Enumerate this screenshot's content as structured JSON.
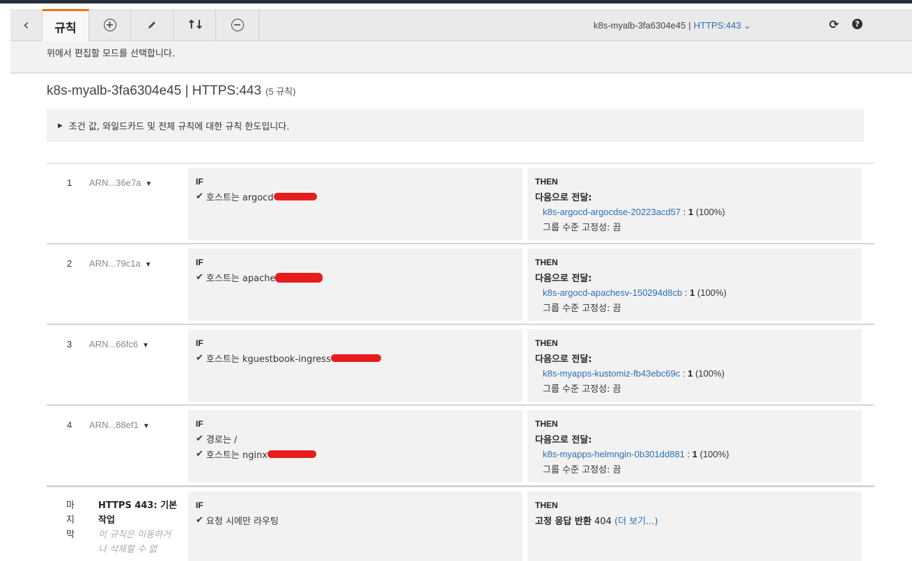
{
  "toolbar": {
    "back_icon": "chevron-left-icon",
    "rules_tab_label": "규칙",
    "add_icon": "plus-circle-icon",
    "edit_icon": "pencil-icon",
    "reorder_icon": "reorder-arrows-icon",
    "remove_icon": "minus-circle-icon",
    "listener_name": "k8s-myalb-3fa6304e45",
    "listener_separator": "|",
    "listener_port": "HTTPS:443",
    "refresh_icon": "refresh-icon",
    "help_icon": "help-icon",
    "accent_color": "#ec7211"
  },
  "mode_hint": "위에서 편집할 모드를 선택합니다.",
  "page": {
    "title": "k8s-myalb-3fa6304e45 | HTTPS:443",
    "rule_count": "(5 규칙)"
  },
  "info_box": {
    "text": "조건 값, 와일드카드 및 전체 규칙에 대한 규칙 한도입니다."
  },
  "labels": {
    "if": "IF",
    "then": "THEN",
    "forward_to": "다음으로 전달:",
    "stickiness": "그룹 수준 고정성: 끔",
    "link_color": "#2a6fb3",
    "redaction_color": "#e81c1c"
  },
  "rules": [
    {
      "number": "1",
      "arn": "ARN...36e7a",
      "conditions": [
        {
          "text": "호스트는 argocd",
          "redacted": true
        }
      ],
      "target_group": "k8s-argocd-argocdse-20223acd57",
      "weight": "1",
      "weight_pct": "(100%)"
    },
    {
      "number": "2",
      "arn": "ARN...79c1a",
      "conditions": [
        {
          "text": "호스트는 apache",
          "redacted": true
        }
      ],
      "target_group": "k8s-argocd-apachesv-150294d8cb",
      "weight": "1",
      "weight_pct": "(100%)"
    },
    {
      "number": "3",
      "arn": "ARN...66fc6",
      "conditions": [
        {
          "text": "호스트는 kguestbook-ingress",
          "redacted": true
        }
      ],
      "target_group": "k8s-myapps-kustomiz-fb43ebc69c",
      "weight": "1",
      "weight_pct": "(100%)"
    },
    {
      "number": "4",
      "arn": "ARN...88ef1",
      "conditions": [
        {
          "text": "경로는 /",
          "redacted": false
        },
        {
          "text": "호스트는 nginx",
          "redacted": true
        }
      ],
      "target_group": "k8s-myapps-helmngin-0b301dd881",
      "weight": "1",
      "weight_pct": "(100%)"
    }
  ],
  "default_rule": {
    "last_label": "마지막",
    "title": "HTTPS 443: 기본 작업",
    "note": "이 규칙은 이동하거나 삭제할 수 없",
    "condition": "요청 시에만 라우팅",
    "action_label": "고정 응답 반환",
    "status_code": "404",
    "more_link": "(더 보기...)"
  }
}
